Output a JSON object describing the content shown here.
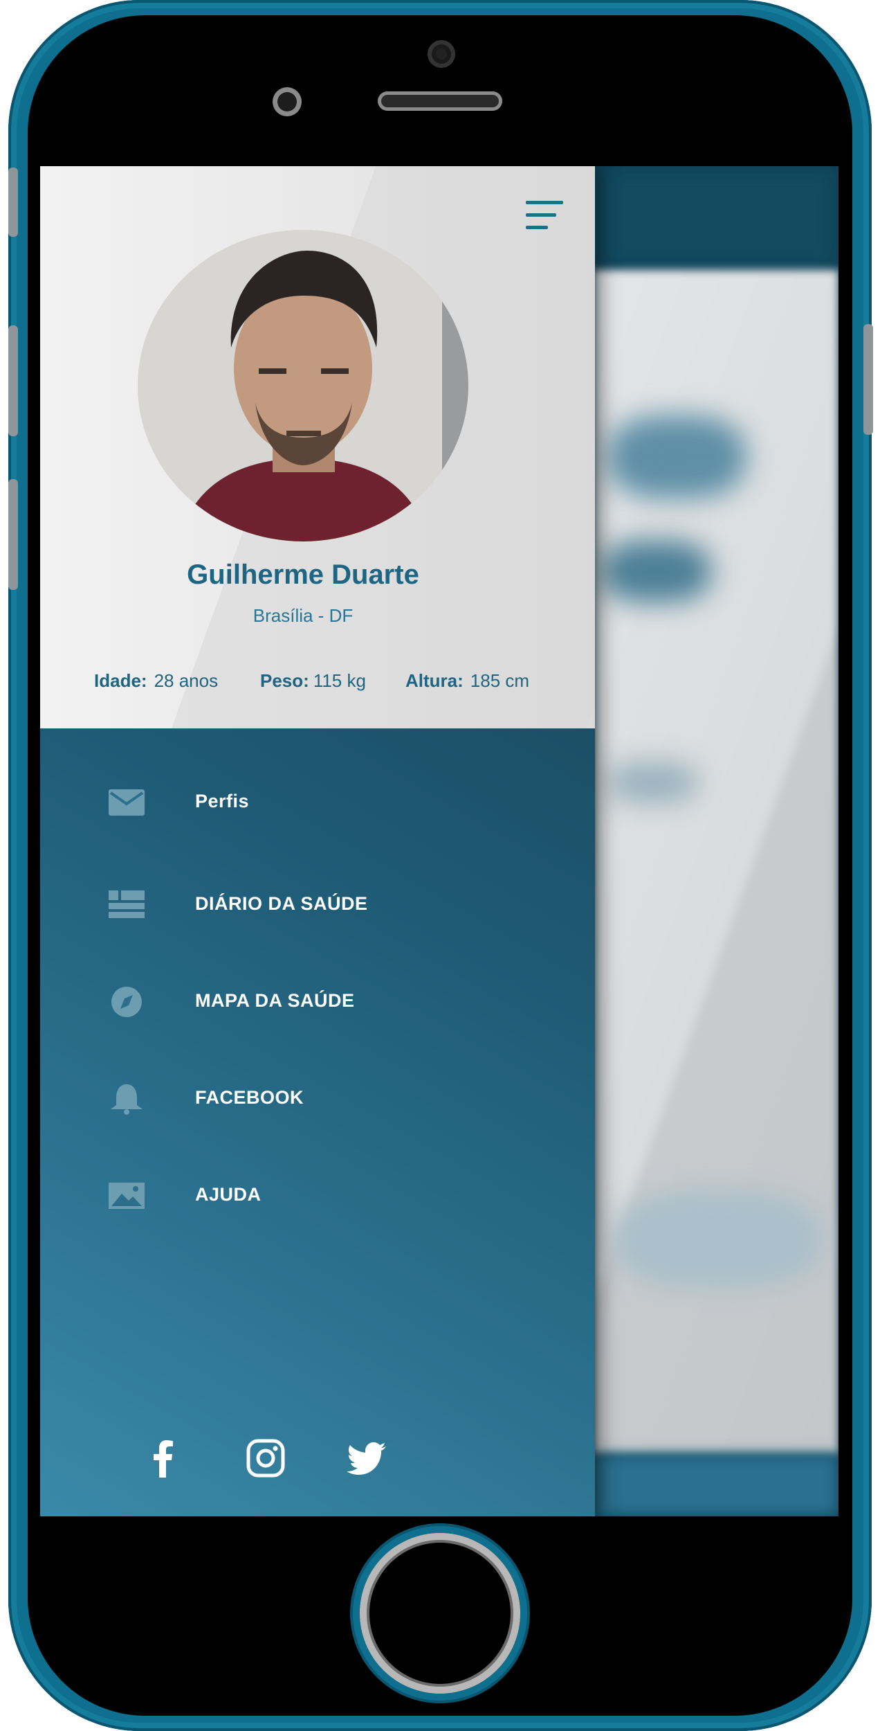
{
  "profile": {
    "name": "Guilherme Duarte",
    "location": "Brasília - DF",
    "stats": [
      {
        "label": "Idade:",
        "value": "28 anos"
      },
      {
        "label": "Peso:",
        "value": "115 kg"
      },
      {
        "label": "Altura:",
        "value": "185 cm"
      }
    ]
  },
  "menu": [
    {
      "label": "Perfis",
      "icon": "envelope-icon"
    },
    {
      "label": "DIÁRIO DA SAÚDE",
      "icon": "news-icon"
    },
    {
      "label": "MAPA DA SAÚDE",
      "icon": "compass-icon"
    },
    {
      "label": "FACEBOOK",
      "icon": "bell-icon"
    },
    {
      "label": "AJUDA",
      "icon": "image-icon"
    }
  ],
  "social": [
    "facebook-icon",
    "instagram-icon",
    "twitter-icon"
  ],
  "colors": {
    "accent": "#1e6583",
    "drawer_bg_start": "#3a89a8",
    "drawer_bg_end": "#1b4f66",
    "phone_frame": "#0f6f8f"
  }
}
